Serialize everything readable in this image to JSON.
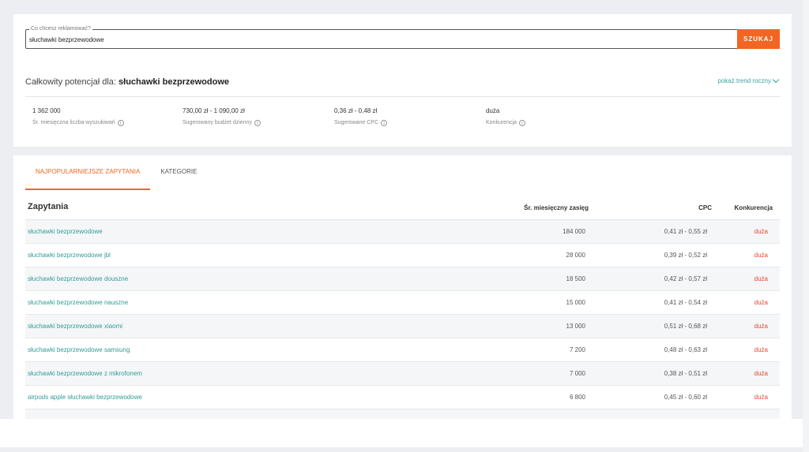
{
  "search": {
    "legend": "Co chcesz reklamować?",
    "value": "słuchawki bezprzewodowe",
    "button_label": "SZUKAJ"
  },
  "potential": {
    "prefix": "Całkowity potencjał dla: ",
    "keyword": "słuchawki bezprzewodowe",
    "trend_link": "pokaż trend roczny"
  },
  "stats": [
    {
      "value": "1 362 000",
      "label": "Śr. miesięczna liczba wyszukiwań"
    },
    {
      "value": "730,00 zł - 1 090,00 zł",
      "label": "Sugerowany budżet dzienny"
    },
    {
      "value": "0,36 zł - 0,48 zł",
      "label": "Sugerowane CPC"
    },
    {
      "value": "duża",
      "label": "Konkurencja"
    }
  ],
  "tabs": [
    {
      "label": "NAJPOPULARNIEJSZE ZAPYTANIA",
      "active": true
    },
    {
      "label": "KATEGORIE",
      "active": false
    }
  ],
  "table": {
    "headers": {
      "query": "Zapytania",
      "reach": "Śr. miesięczny zasięg",
      "cpc": "CPC",
      "competition": "Konkurencja"
    },
    "rows": [
      {
        "query": "słuchawki bezprzewodowe",
        "reach": "184 000",
        "cpc": "0,41 zł - 0,55 zł",
        "competition": "duża"
      },
      {
        "query": "słuchawki bezprzewodowe jbl",
        "reach": "28 000",
        "cpc": "0,39 zł - 0,52 zł",
        "competition": "duża"
      },
      {
        "query": "słuchawki bezprzewodowe douszne",
        "reach": "18 500",
        "cpc": "0,42 zł - 0,57 zł",
        "competition": "duża"
      },
      {
        "query": "słuchawki bezprzewodowe nauszne",
        "reach": "15 000",
        "cpc": "0,41 zł - 0,54 zł",
        "competition": "duża"
      },
      {
        "query": "słuchawki bezprzewodowe xiaomi",
        "reach": "13 000",
        "cpc": "0,51 zł - 0,68 zł",
        "competition": "duża"
      },
      {
        "query": "słuchawki bezprzewodowe samsung",
        "reach": "7 200",
        "cpc": "0,48 zł - 0,63 zł",
        "competition": "duża"
      },
      {
        "query": "słuchawki bezprzewodowe z mikrofonem",
        "reach": "7 000",
        "cpc": "0,38 zł - 0,51 zł",
        "competition": "duża"
      },
      {
        "query": "airpods apple słuchawki bezprzewodowe",
        "reach": "6 800",
        "cpc": "0,45 zł - 0,60 zł",
        "competition": "duża"
      },
      {
        "query": "",
        "reach": "",
        "cpc": "",
        "competition": ""
      }
    ]
  },
  "colors": {
    "accent": "#f26522",
    "link": "#2f9e96",
    "competition_high": "#e2492f"
  }
}
